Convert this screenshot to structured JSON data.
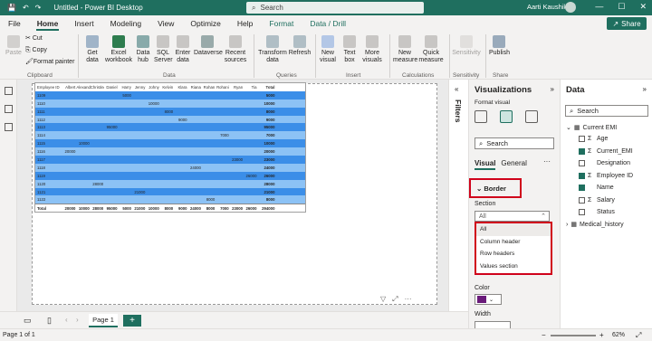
{
  "titlebar": {
    "title": "Untitled - Power BI Desktop",
    "search_placeholder": "Search",
    "user": "Aarti Kaushik"
  },
  "menu": [
    "File",
    "Home",
    "Insert",
    "Modeling",
    "View",
    "Optimize",
    "Help",
    "Format",
    "Data / Drill"
  ],
  "share_label": "Share",
  "ribbon": {
    "paste": "Paste",
    "cut": "Cut",
    "copy": "Copy",
    "format_painter": "Format painter",
    "get_data": "Get\ndata",
    "excel": "Excel\nworkbook",
    "data_hub": "Data\nhub",
    "sql": "SQL\nServer",
    "enter_data": "Enter\ndata",
    "dataverse": "Dataverse",
    "recent": "Recent\nsources",
    "transform": "Transform\ndata",
    "refresh": "Refresh",
    "new_visual": "New\nvisual",
    "text_box": "Text\nbox",
    "more_visuals": "More\nvisuals",
    "new_measure": "New\nmeasure",
    "quick_measure": "Quick\nmeasure",
    "sensitivity": "Sensitivity",
    "publish": "Publish",
    "groups": {
      "clipboard": "Clipboard",
      "data": "Data",
      "queries": "Queries",
      "insert": "Insert",
      "calculations": "Calculations",
      "sensitivity": "Sensitivity",
      "share": "Share"
    }
  },
  "matrix": {
    "headers": [
      "Employee ID",
      "Albert",
      "Alexander",
      "Christine",
      "Daniel",
      "Harry",
      "Jenny",
      "Johny",
      "Kelvin",
      "Klara",
      "Riana",
      "Rohan",
      "Rohani",
      "Ryan",
      "Tia",
      "Total"
    ],
    "rows": [
      [
        "1109",
        "",
        "",
        "",
        "",
        "5000",
        "",
        "",
        "",
        "",
        "",
        "",
        "",
        "",
        "",
        "5000"
      ],
      [
        "1110",
        "",
        "",
        "",
        "",
        "",
        "",
        "10000",
        "",
        "",
        "",
        "",
        "",
        "",
        "",
        "10000"
      ],
      [
        "1111",
        "",
        "",
        "",
        "",
        "",
        "",
        "",
        "8000",
        "",
        "",
        "",
        "",
        "",
        "",
        "8000"
      ],
      [
        "1112",
        "",
        "",
        "",
        "",
        "",
        "",
        "",
        "",
        "9000",
        "",
        "",
        "",
        "",
        "",
        "9000"
      ],
      [
        "1113",
        "",
        "",
        "",
        "95000",
        "",
        "",
        "",
        "",
        "",
        "",
        "",
        "",
        "",
        "",
        "95000"
      ],
      [
        "1114",
        "",
        "",
        "",
        "",
        "",
        "",
        "",
        "",
        "",
        "",
        "",
        "7000",
        "",
        "",
        "7000"
      ],
      [
        "1115",
        "",
        "10000",
        "",
        "",
        "",
        "",
        "",
        "",
        "",
        "",
        "",
        "",
        "",
        "",
        "10000"
      ],
      [
        "1116",
        "20000",
        "",
        "",
        "",
        "",
        "",
        "",
        "",
        "",
        "",
        "",
        "",
        "",
        "",
        "20000"
      ],
      [
        "1117",
        "",
        "",
        "",
        "",
        "",
        "",
        "",
        "",
        "",
        "",
        "",
        "",
        "23000",
        "",
        "23000"
      ],
      [
        "1118",
        "",
        "",
        "",
        "",
        "",
        "",
        "",
        "",
        "",
        "24000",
        "",
        "",
        "",
        "",
        "24000"
      ],
      [
        "1119",
        "",
        "",
        "",
        "",
        "",
        "",
        "",
        "",
        "",
        "",
        "",
        "",
        "",
        "26000",
        "26000"
      ],
      [
        "1120",
        "",
        "",
        "28000",
        "",
        "",
        "",
        "",
        "",
        "",
        "",
        "",
        "",
        "",
        "",
        "28000"
      ],
      [
        "1121",
        "",
        "",
        "",
        "",
        "",
        "21000",
        "",
        "",
        "",
        "",
        "",
        "",
        "",
        "",
        "21000"
      ],
      [
        "1122",
        "",
        "",
        "",
        "",
        "",
        "",
        "",
        "",
        "",
        "",
        "8000",
        "",
        "",
        "",
        "8000"
      ]
    ],
    "total_row": [
      "Total",
      "20000",
      "10000",
      "28000",
      "95000",
      "5000",
      "21000",
      "10000",
      "8000",
      "9000",
      "24000",
      "8000",
      "7000",
      "23000",
      "26000",
      "294000"
    ]
  },
  "filters_label": "Filters",
  "viz": {
    "title": "Visualizations",
    "subtitle": "Format visual",
    "search": "Search",
    "tab_visual": "Visual",
    "tab_general": "General",
    "more": "···",
    "border_label": "Border",
    "section_label": "Section",
    "section_value": "All",
    "options": [
      "All",
      "Column header",
      "Row headers",
      "Values section"
    ],
    "color_label": "Color",
    "width_label": "Width",
    "color_value": "#6a1b7a"
  },
  "data_pane": {
    "title": "Data",
    "search": "Search",
    "table1": "Current EMI",
    "fields": [
      {
        "name": "Age",
        "sigma": true,
        "checked": false
      },
      {
        "name": "Current_EMI",
        "sigma": true,
        "checked": true
      },
      {
        "name": "Designation",
        "sigma": false,
        "checked": false
      },
      {
        "name": "Employee ID",
        "sigma": true,
        "checked": true
      },
      {
        "name": "Name",
        "sigma": false,
        "checked": true
      },
      {
        "name": "Salary",
        "sigma": true,
        "checked": false
      },
      {
        "name": "Status",
        "sigma": false,
        "checked": false
      }
    ],
    "table2": "Medical_history"
  },
  "pages": {
    "tab": "Page 1",
    "add": "+"
  },
  "status": {
    "page": "Page 1 of 1",
    "zoom": "62%"
  }
}
